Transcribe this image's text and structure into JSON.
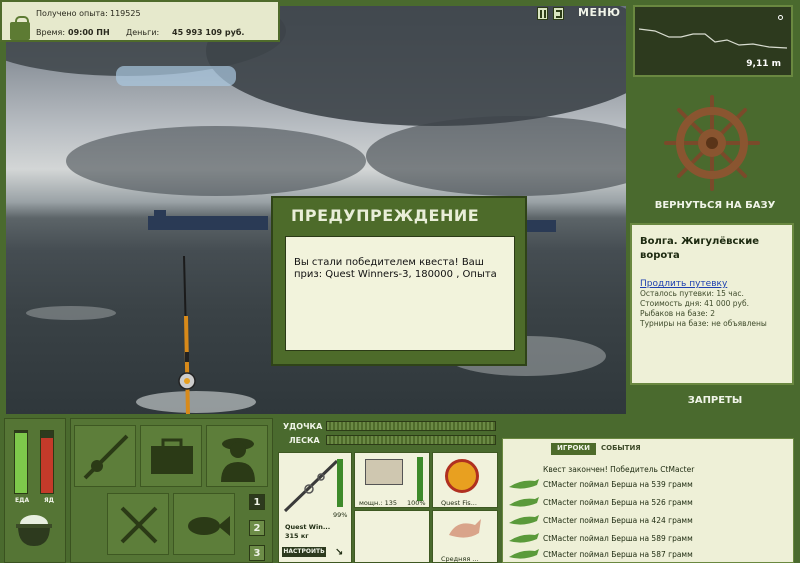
{
  "status": {
    "experience_label": "Получено опыта:",
    "experience_value": "119525",
    "time_label": "Время:",
    "time_value": "09:00 ПН",
    "money_label": "Деньги:",
    "money_value": "45 993 109 руб."
  },
  "topbar": {
    "menu_label": "МЕНЮ"
  },
  "depth": {
    "value": "9,11 m"
  },
  "right": {
    "return_label": "ВЕРНУТЬСЯ НА БАЗУ",
    "location_title": "Волга. Жигулёвские ворота",
    "extend_link": "Продлить путевку",
    "lines": [
      "Осталось путевки: 15 час.",
      "Стоимость дня: 41 000 руб.",
      "Рыбаков на базе: 2",
      "Турниры на базе: не объявлены"
    ],
    "bans_label": "ЗАПРЕТЫ"
  },
  "dialog": {
    "title": "ПРЕДУПРЕЖДЕНИЕ",
    "message": "Вы стали победителем квеста! Ваш приз: Quest Winners-3, 180000 , Опыта"
  },
  "bottom": {
    "food_label": "ЕДА",
    "poison_label": "ЯД",
    "rod_label": "УДОЧКА",
    "line_label": "ЛЕСКА",
    "rod_percent": "99%",
    "rod_name": "Quest Win...",
    "rod_weight": "315 кг",
    "setup_button": "НАСТРОИТЬ",
    "reel_power": "мощн.: 135",
    "reel_percent": "100%",
    "line_name": "Quest Fis...",
    "lure_name": "Средняя ...",
    "slots": [
      "1",
      "2",
      "3"
    ]
  },
  "events": {
    "tab_players": "ИГРОКИ",
    "tab_events": "СОБЫТИЯ",
    "header": "Квест закончен! Победитель CtMacter",
    "lines": [
      "CtMacter поймал Берша на 539 грамм",
      "CtMacter поймал Берша на 526 грамм",
      "CtMacter поймал Берша на 424 грамм",
      "CtMacter поймал Берша на 589 грамм",
      "CtMacter поймал Берша на 587 грамм"
    ]
  },
  "colors": {
    "panel_green": "#4a6a2e",
    "cream": "#eef0d7",
    "dark_green": "#2f4318"
  }
}
